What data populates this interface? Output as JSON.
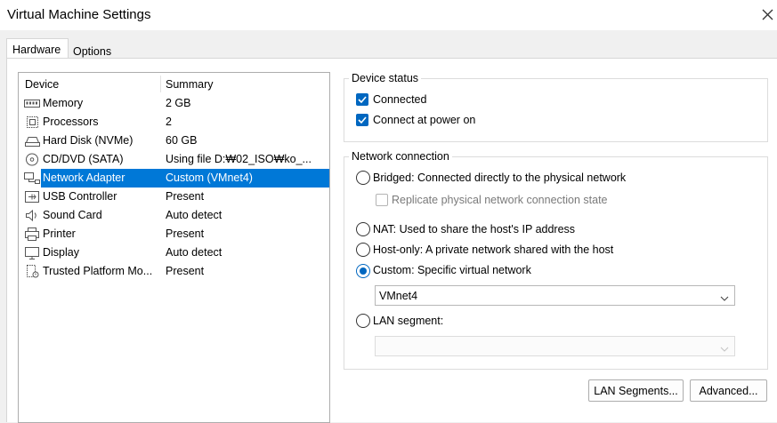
{
  "window": {
    "title": "Virtual Machine Settings",
    "close_icon": "close-icon"
  },
  "tabs": [
    {
      "label": "Hardware",
      "active": true
    },
    {
      "label": "Options",
      "active": false
    }
  ],
  "device_list": {
    "columns": [
      "Device",
      "Summary"
    ],
    "rows": [
      {
        "device": "Memory",
        "summary": "2 GB",
        "icon": "memory-icon"
      },
      {
        "device": "Processors",
        "summary": "2",
        "icon": "processor-icon"
      },
      {
        "device": "Hard Disk (NVMe)",
        "summary": "60 GB",
        "icon": "hard-disk-icon"
      },
      {
        "device": "CD/DVD (SATA)",
        "summary": "Using file D:₩02_ISO₩ko_...",
        "icon": "cd-dvd-icon"
      },
      {
        "device": "Network Adapter",
        "summary": "Custom (VMnet4)",
        "icon": "network-adapter-icon",
        "selected": true
      },
      {
        "device": "USB Controller",
        "summary": "Present",
        "icon": "usb-icon"
      },
      {
        "device": "Sound Card",
        "summary": "Auto detect",
        "icon": "speaker-icon"
      },
      {
        "device": "Printer",
        "summary": "Present",
        "icon": "printer-icon"
      },
      {
        "device": "Display",
        "summary": "Auto detect",
        "icon": "display-icon"
      },
      {
        "device": "Trusted Platform Mo...",
        "summary": "Present",
        "icon": "tpm-icon"
      }
    ],
    "selection_color": "#0078d7"
  },
  "device_status": {
    "title": "Device status",
    "connected": {
      "label": "Connected",
      "checked": true
    },
    "connect_at_power_on": {
      "label": "Connect at power on",
      "checked": true
    }
  },
  "network_connection": {
    "title": "Network connection",
    "bridged": {
      "label": "Bridged: Connected directly to the physical network",
      "selected": false
    },
    "replicate": {
      "label": "Replicate physical network connection state",
      "checked": false,
      "enabled": false
    },
    "nat": {
      "label": "NAT: Used to share the host's IP address",
      "selected": false
    },
    "host_only": {
      "label": "Host-only: A private network shared with the host",
      "selected": false
    },
    "custom": {
      "label": "Custom: Specific virtual network",
      "selected": true
    },
    "custom_network": {
      "value": "VMnet4"
    },
    "lan_segment": {
      "label": "LAN segment:",
      "selected": false
    },
    "lan_segment_value": {
      "value": ""
    }
  },
  "buttons": {
    "lan_segments": "LAN Segments...",
    "advanced": "Advanced..."
  },
  "colors": {
    "accent": "#0067c0",
    "selection": "#0078d7"
  }
}
